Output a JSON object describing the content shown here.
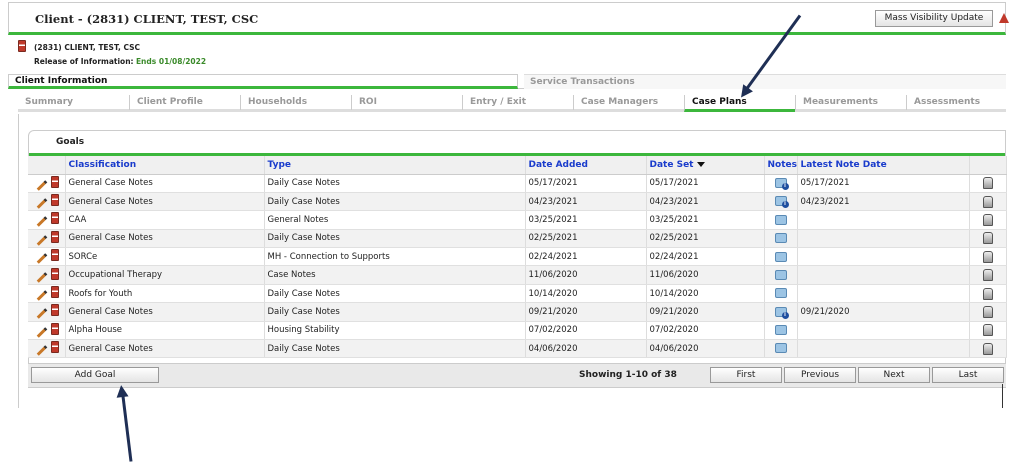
{
  "header": {
    "title": "Client - (2831) CLIENT, TEST, CSC",
    "mass_visibility_button": "Mass Visibility Update"
  },
  "client": {
    "name": "(2831) CLIENT, TEST, CSC",
    "roi_label": "Release of Information:",
    "roi_value": "Ends 01/08/2022"
  },
  "main_tabs": [
    {
      "label": "Client Information",
      "active": true
    },
    {
      "label": "Service Transactions",
      "active": false
    }
  ],
  "sub_tabs": [
    {
      "label": "Summary"
    },
    {
      "label": "Client Profile"
    },
    {
      "label": "Households"
    },
    {
      "label": "ROI"
    },
    {
      "label": "Entry / Exit"
    },
    {
      "label": "Case Managers"
    },
    {
      "label": "Case Plans",
      "active": true
    },
    {
      "label": "Measurements"
    },
    {
      "label": "Assessments"
    }
  ],
  "goals": {
    "title": "Goals",
    "columns": {
      "classification": "Classification",
      "type": "Type",
      "date_added": "Date Added",
      "date_set": "Date Set",
      "notes": "Notes",
      "latest_note_date": "Latest Note Date"
    },
    "sort_column": "date_set",
    "rows": [
      {
        "classification": "General Case Notes",
        "type": "Daily Case Notes",
        "date_added": "05/17/2021",
        "date_set": "05/17/2021",
        "has_note_info": true,
        "latest_note_date": "05/17/2021"
      },
      {
        "classification": "General Case Notes",
        "type": "Daily Case Notes",
        "date_added": "04/23/2021",
        "date_set": "04/23/2021",
        "has_note_info": true,
        "latest_note_date": "04/23/2021"
      },
      {
        "classification": "CAA",
        "type": "General Notes",
        "date_added": "03/25/2021",
        "date_set": "03/25/2021",
        "has_note_info": false,
        "latest_note_date": ""
      },
      {
        "classification": "General Case Notes",
        "type": "Daily Case Notes",
        "date_added": "02/25/2021",
        "date_set": "02/25/2021",
        "has_note_info": false,
        "latest_note_date": ""
      },
      {
        "classification": "SORCe",
        "type": "MH - Connection to Supports",
        "date_added": "02/24/2021",
        "date_set": "02/24/2021",
        "has_note_info": false,
        "latest_note_date": ""
      },
      {
        "classification": "Occupational Therapy",
        "type": "Case Notes",
        "date_added": "11/06/2020",
        "date_set": "11/06/2020",
        "has_note_info": false,
        "latest_note_date": ""
      },
      {
        "classification": "Roofs for Youth",
        "type": "Daily Case Notes",
        "date_added": "10/14/2020",
        "date_set": "10/14/2020",
        "has_note_info": false,
        "latest_note_date": ""
      },
      {
        "classification": "General Case Notes",
        "type": "Daily Case Notes",
        "date_added": "09/21/2020",
        "date_set": "09/21/2020",
        "has_note_info": true,
        "latest_note_date": "09/21/2020"
      },
      {
        "classification": "Alpha House",
        "type": "Housing Stability",
        "date_added": "07/02/2020",
        "date_set": "07/02/2020",
        "has_note_info": false,
        "latest_note_date": ""
      },
      {
        "classification": "General Case Notes",
        "type": "Daily Case Notes",
        "date_added": "04/06/2020",
        "date_set": "04/06/2020",
        "has_note_info": false,
        "latest_note_date": ""
      }
    ],
    "add_button": "Add Goal",
    "showing": "Showing 1-10 of 38",
    "pager": {
      "first": "First",
      "previous": "Previous",
      "next": "Next",
      "last": "Last"
    }
  },
  "icons": {
    "edit": "pencil-icon",
    "delete": "trash-icon",
    "notes": "notes-icon",
    "attach": "clip-icon"
  },
  "colors": {
    "accent_green": "#3cb73c",
    "link_blue": "#1a3ccc",
    "arrow": "#1f2f55"
  }
}
